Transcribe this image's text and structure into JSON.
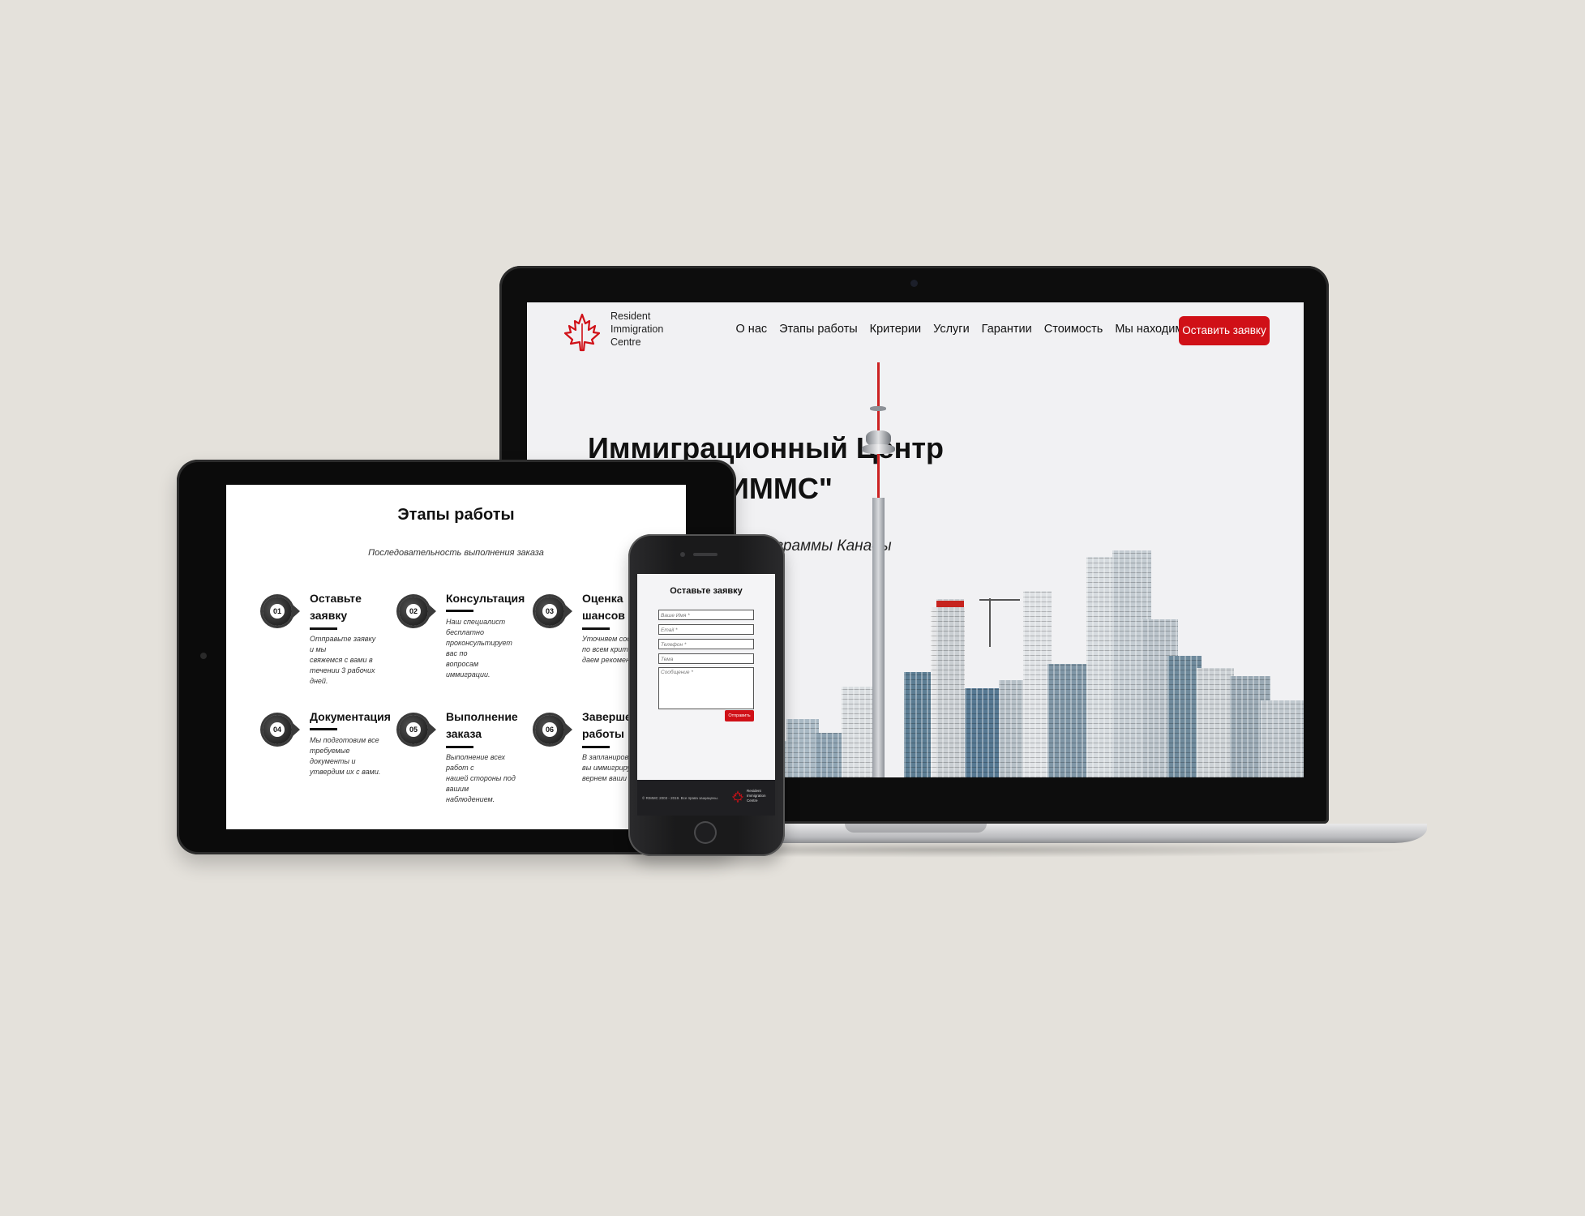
{
  "laptop": {
    "logo_text": [
      "Resident",
      "Immigration",
      "Centre"
    ],
    "nav": [
      {
        "label": "О нас"
      },
      {
        "label": "Этапы работы"
      },
      {
        "label": "Критерии"
      },
      {
        "label": "Услуги"
      },
      {
        "label": "Гарантии"
      },
      {
        "label": "Стоимость"
      },
      {
        "label": "Мы находимся"
      }
    ],
    "cta_label": "Оставить заявку",
    "hero": {
      "line1": "Иммиграционный Центр",
      "line2": "ИММС\"",
      "subtitle": "ограммы Канады"
    },
    "accent_color": "#d01017"
  },
  "tablet": {
    "title": "Этапы работы",
    "subtitle": "Последовательность выполнения заказа",
    "steps": [
      {
        "num": "01",
        "title_lines": [
          "Оставьте",
          "заявку"
        ],
        "text_lines": [
          "Отправьте заявку и мы",
          "свяжемся с вами в",
          "течении 3 рабочих дней."
        ]
      },
      {
        "num": "02",
        "title_lines": [
          "Консультация"
        ],
        "text_lines": [
          "Наш специалист",
          "бесплатно",
          "проконсультирует вас по",
          "вопросам иммиграции."
        ]
      },
      {
        "num": "03",
        "title_lines": [
          "Оценка",
          "шансов"
        ],
        "text_lines": [
          "Уточняем соотв",
          "по всем критери",
          "даем рекоменда"
        ]
      },
      {
        "num": "04",
        "title_lines": [
          "Документация"
        ],
        "text_lines": [
          "Мы подготовим все",
          "требуемые документы и",
          "утвердим их с вами."
        ]
      },
      {
        "num": "05",
        "title_lines": [
          "Выполнение",
          "заказа"
        ],
        "text_lines": [
          "Выполнение всех работ с",
          "нашей стороны под",
          "вашим наблюдением."
        ]
      },
      {
        "num": "06",
        "title_lines": [
          "Завершен",
          "работы"
        ],
        "text_lines": [
          "В запланирован",
          "вы иммигрируе",
          "вернем ваши сред"
        ]
      }
    ]
  },
  "phone": {
    "form_title": "Оставьте заявку",
    "fields": {
      "name": "Ваше Имя *",
      "email": "Email *",
      "phone": "Телефон *",
      "subject": "Тема",
      "message": "Сообщение *"
    },
    "send_label": "Отправить",
    "copyright": "© RIMMC 2003 - 2019. Все права защищены.",
    "footer_logo_text": [
      "Resident",
      "Immigration",
      "Centre"
    ]
  }
}
